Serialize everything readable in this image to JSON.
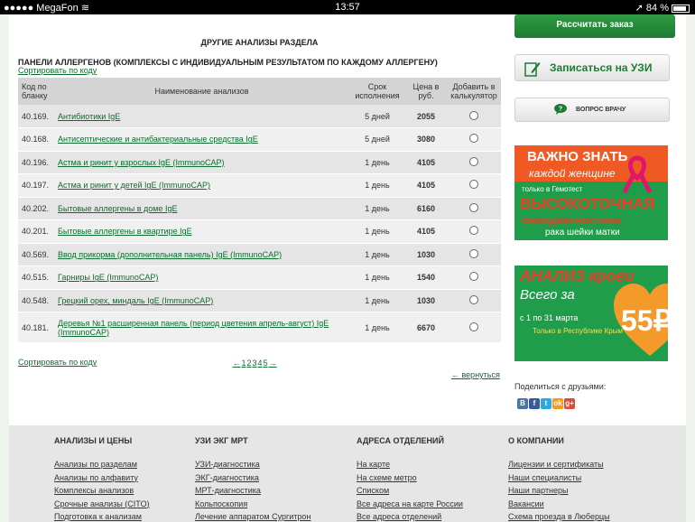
{
  "statusbar": {
    "carrier": "●●●●● MegaFon",
    "wifi": "≋",
    "time": "13:57",
    "location": "➚",
    "battery": "84 %"
  },
  "section_title": "ДРУГИЕ АНАЛИЗЫ РАЗДЕЛА",
  "panel_title": "ПАНЕЛИ АЛЛЕРГЕНОВ (КОМПЛЕКСЫ С ИНДИВИДУАЛЬНЫМ РЕЗУЛЬТАТОМ ПО КАЖДОМУ АЛЛЕРГЕНУ)",
  "sort_label": "Сортировать по коду",
  "table": {
    "headers": {
      "code": "Код по бланку",
      "name": "Наименование анализов",
      "term": "Срок исполнения",
      "price": "Цена в руб.",
      "add": "Добавить в калькулятор"
    },
    "rows": [
      {
        "code": "40.169.",
        "name": "Антибиотики IgE",
        "term": "5 дней",
        "price": "2055"
      },
      {
        "code": "40.168.",
        "name": "Антисептические и антибактериальные средства IgE",
        "term": "5 дней",
        "price": "3080"
      },
      {
        "code": "40.196.",
        "name": "Астма и ринит у взрослых IgE (ImmunoCAP)",
        "term": "1 день",
        "price": "4105"
      },
      {
        "code": "40.197.",
        "name": "Астма и ринит у детей IgE (ImmunoCAP)",
        "term": "1 день",
        "price": "4105"
      },
      {
        "code": "40.202.",
        "name": "Бытовые аллергены в доме IgE",
        "term": "1 день",
        "price": "6160"
      },
      {
        "code": "40.201.",
        "name": "Бытовые аллергены в квартире IgE",
        "term": "1 день",
        "price": "4105"
      },
      {
        "code": "40.569.",
        "name": "Ввод прикорма (дополнительная панель) IgE (ImmunoCAP)",
        "term": "1 день",
        "price": "1030"
      },
      {
        "code": "40.515.",
        "name": "Гарниры IgE (ImmunoCAP)",
        "term": "1 день",
        "price": "1540"
      },
      {
        "code": "40.548.",
        "name": "Грецкий орех, миндаль IgE (ImmunoCAP)",
        "term": "1 день",
        "price": "1030"
      },
      {
        "code": "40.181.",
        "name": "Деревья №1 расширенная панель (период цветения апрель-август) IgE (ImmunoCAP)",
        "term": "1 день",
        "price": "6670"
      }
    ]
  },
  "pagination": {
    "prev": "←",
    "pages": [
      "1",
      "2",
      "3",
      "4",
      "5"
    ],
    "next": "→"
  },
  "back_link": "← вернуться",
  "sidebar": {
    "calc_button": "Рассчитать заказ",
    "uzi_button": "Записаться на УЗИ",
    "doctor_button": "ВОПРОС ВРАЧУ",
    "banner1": {
      "line1": "ВАЖНО ЗНАТЬ",
      "line2": "каждой женщине",
      "line3": "только в Гемотест",
      "line4": "ВЫСОКОТОЧНАЯ",
      "line5": "онкодиагностика",
      "line6": "рака шейки матки"
    },
    "banner2": {
      "line1": "АНАЛИЗ крови",
      "line2": "Всего за",
      "line3": "с 1 по 31 марта",
      "line4": "Только в Республике Крым",
      "price": "55₽"
    },
    "share_label": "Поделиться с друзьями:",
    "share_icons": [
      {
        "icon": "vk-icon",
        "glyph": "B",
        "color": "#4c75a3"
      },
      {
        "icon": "facebook-icon",
        "glyph": "f",
        "color": "#3b5998"
      },
      {
        "icon": "twitter-icon",
        "glyph": "t",
        "color": "#2aa9e0"
      },
      {
        "icon": "odnoklassniki-icon",
        "glyph": "ok",
        "color": "#f59a1b"
      },
      {
        "icon": "google-plus-icon",
        "glyph": "g+",
        "color": "#dd4b39"
      }
    ]
  },
  "footer": {
    "columns": [
      {
        "title": "АНАЛИЗЫ И ЦЕНЫ",
        "links": [
          "Анализы по разделам",
          "Анализы по алфавиту",
          "Комплексы анализов",
          "Срочные анализы (CITO)",
          "Подготовка к анализам"
        ]
      },
      {
        "title": "УЗИ ЭКГ МРТ",
        "links": [
          "УЗИ-диагностика",
          "ЭКГ-диагностика",
          "МРТ-диагностика",
          "Кольпоскопия",
          "Лечение аппаратом Сургитрон"
        ]
      },
      {
        "title": "АДРЕСА ОТДЕЛЕНИЙ",
        "links": [
          "На карте",
          "На схеме метро",
          "Списком",
          "Все адреса на карте России",
          "Все адреса отделений"
        ]
      },
      {
        "title": "О КОМПАНИИ",
        "links": [
          "Лицензии и сертификаты",
          "Наши специалисты",
          "Наши партнеры",
          "Вакансии",
          "Схема проезда в Люберцы"
        ]
      }
    ]
  }
}
